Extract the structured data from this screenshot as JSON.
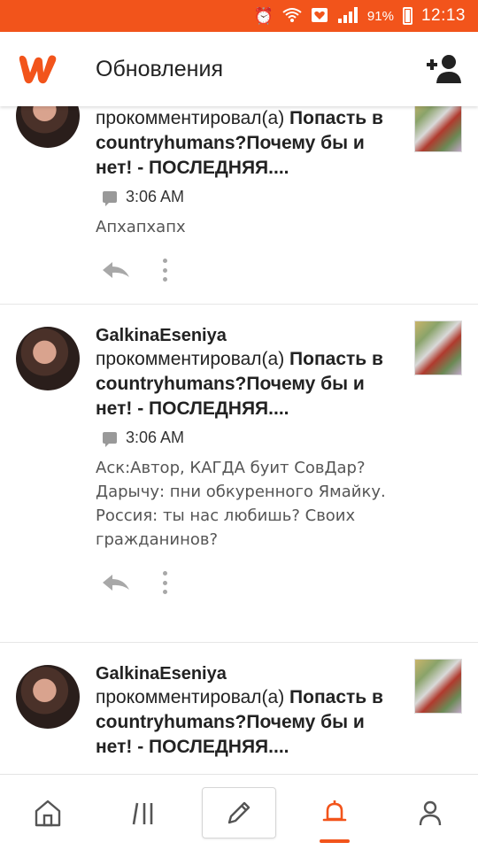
{
  "statusbar": {
    "battery_percent": "91%",
    "time": "12:13"
  },
  "appbar": {
    "title": "Обновления"
  },
  "colors": {
    "brand": "#f2541b",
    "icon_gray": "#a8a8a8"
  },
  "feed": [
    {
      "user": "",
      "action_prefix": "прокомментировал(а) ",
      "story": "Попасть в countryhumans?Почему бы и нет! - ПОСЛЕДНЯЯ....",
      "time": "3:06 AM",
      "comment": [
        "Апхапхапх"
      ]
    },
    {
      "user": "GalkinaEseniya",
      "action_prefix": "прокомментировал(а) ",
      "story": "Попасть в countryhumans?Почему бы и нет! - ПОСЛЕДНЯЯ....",
      "time": "3:06 AM",
      "comment": [
        "Аск:Автор, КАГДА буит СовДар?",
        "Дарычу: пни обкуренного Ямайку.",
        "Россия: ты нас любишь? Своих граждан­инов?"
      ]
    },
    {
      "user": "GalkinaEseniya",
      "action_prefix": "прокомментировал(а) ",
      "story": "Попасть в countryhumans?Почему бы и нет! - ПОСЛЕДНЯЯ....",
      "time": "",
      "comment": []
    }
  ],
  "bottomnav": {
    "items": [
      "home-icon",
      "library-icon",
      "write-icon",
      "notifications-icon",
      "profile-icon"
    ],
    "active": "notifications-icon"
  }
}
